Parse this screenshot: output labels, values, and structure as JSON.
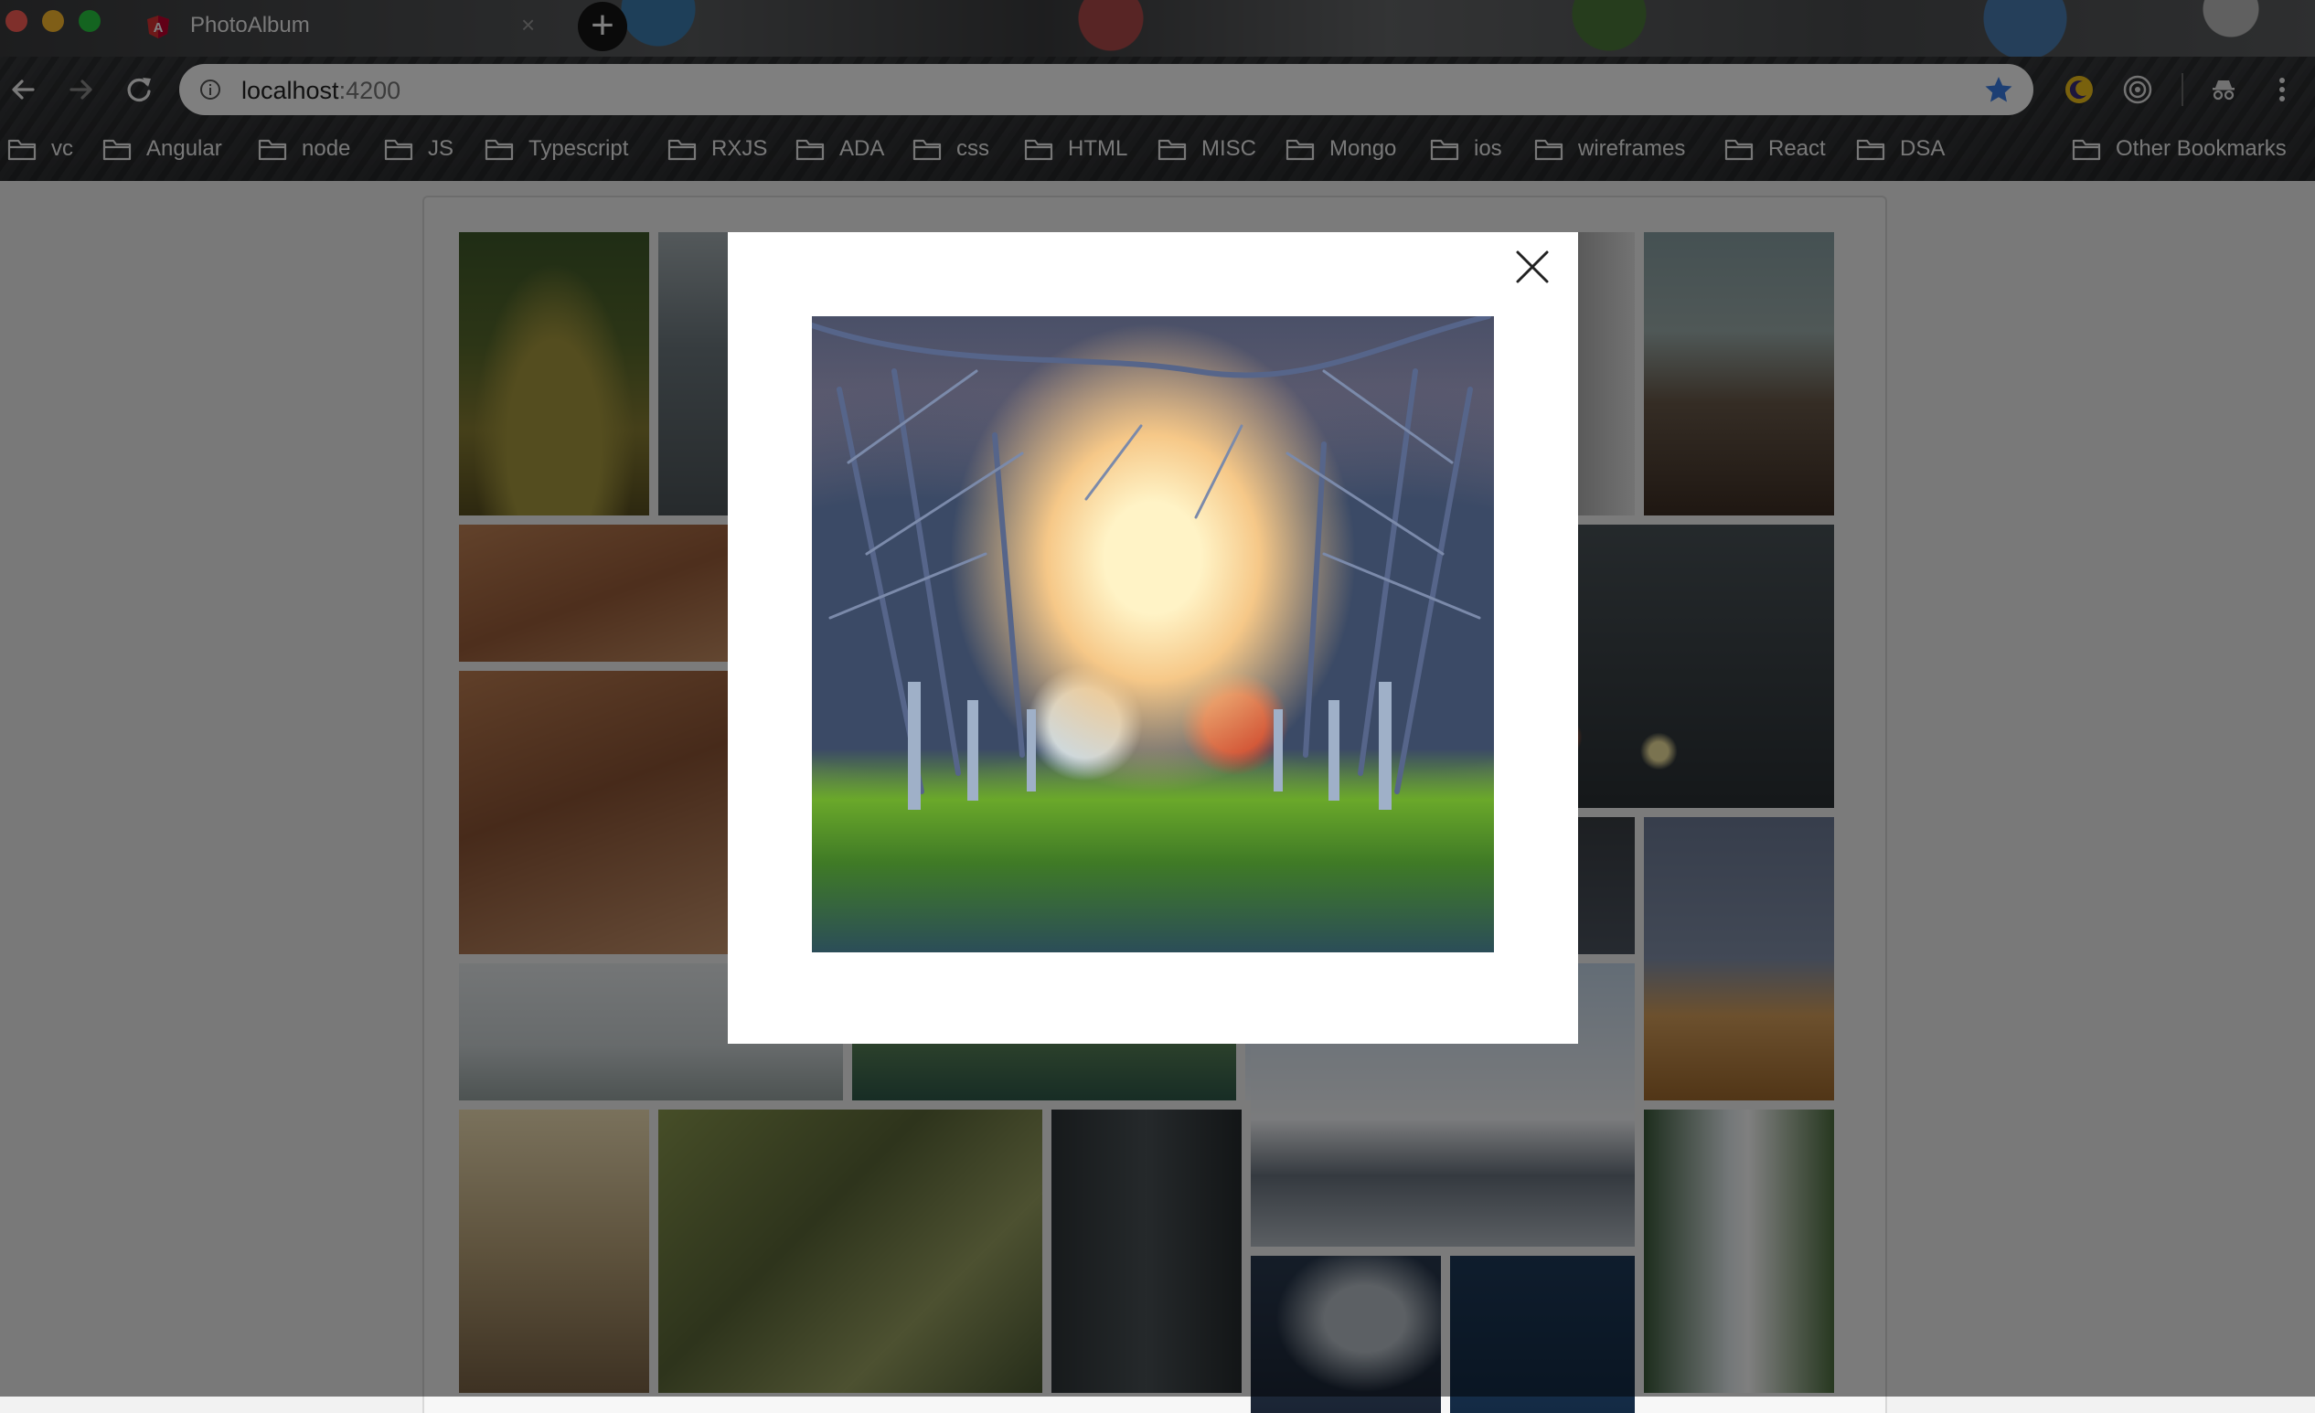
{
  "browser": {
    "tab": {
      "title": "PhotoAlbum",
      "close_glyph": "×",
      "favicon": "angular-logo-icon"
    },
    "new_tab_glyph": "+",
    "address": {
      "host": "localhost",
      "port": ":4200"
    },
    "bookmarks": [
      "vc",
      "Angular",
      "node",
      "JS",
      "Typescript",
      "RXJS",
      "ADA",
      "css",
      "HTML",
      "MISC",
      "Mongo",
      "ios",
      "wireframes",
      "React",
      "DSA"
    ],
    "other_bookmarks": "Other Bookmarks",
    "icons": {
      "back": "arrow-left-icon",
      "forward": "arrow-right-icon",
      "reload": "reload-icon",
      "info": "info-icon",
      "bookmark_star": "star-icon",
      "extensions": [
        "moon-extension-icon",
        "target-extension-icon",
        "incognito-extension-icon"
      ],
      "menu": "kebab-menu-icon"
    }
  },
  "gallery": {
    "thumbnails": [
      "moss-on-log",
      "lake-shore",
      "mountain-valley",
      "leather-and-scissors",
      "rainy-window",
      "leather-and-scissors-large",
      "dark-cloud",
      "foggy-tower",
      "green-field",
      "desert-dune",
      "deer-in-woods",
      "canyon-river",
      "cn-tower",
      "city-skyline",
      "waterfall",
      "night-clouds",
      "starry-sky"
    ]
  },
  "modal": {
    "image": "orchard-trees-with-red-barn",
    "close_icon": "close-icon"
  },
  "colors": {
    "tab_favicon": "#dd3333",
    "star": "#3b7ee8",
    "overlay": "rgba(0,0,0,0.5)"
  }
}
